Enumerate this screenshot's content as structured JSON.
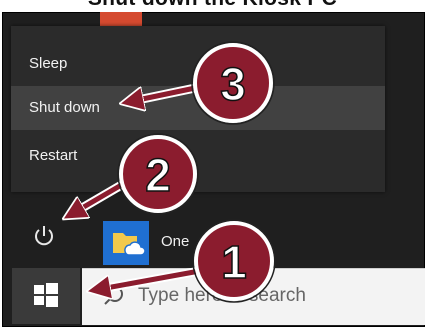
{
  "header": {
    "title": "Shut down the Kiosk PC"
  },
  "power_menu": {
    "items": [
      {
        "label": "Sleep"
      },
      {
        "label": "Shut down"
      },
      {
        "label": "Restart"
      }
    ]
  },
  "start_menu": {
    "app_label": "One"
  },
  "taskbar": {
    "search_text": "Type here to search"
  },
  "steps": {
    "one": "1",
    "two": "2",
    "three": "3"
  },
  "colors": {
    "badge": "#8b1c2e",
    "arrow": "#8b1c2e",
    "app_tile": "#1f6fd1",
    "top_tile": "#d54a30"
  }
}
